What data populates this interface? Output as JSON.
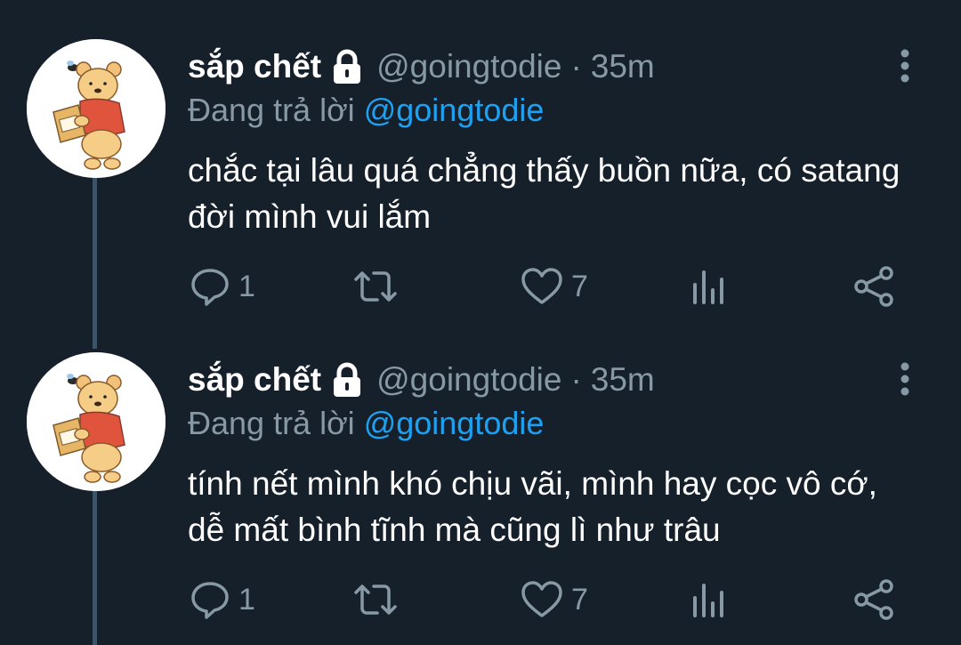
{
  "tweets": [
    {
      "display_name": "sắp chết",
      "handle": "@goingtodie",
      "separator": "·",
      "time": "35m",
      "reply_prefix": "Đang trả lời",
      "reply_to": "@goingtodie",
      "text": "chắc tại lâu quá chẳng thấy buồn nữa, có satang đời mình vui lắm",
      "reply_count": "1",
      "like_count": "7"
    },
    {
      "display_name": "sắp chết",
      "handle": "@goingtodie",
      "separator": "·",
      "time": "35m",
      "reply_prefix": "Đang trả lời",
      "reply_to": "@goingtodie",
      "text": "tính nết mình khó chịu vãi, mình hay cọc vô cớ, dễ mất bình tĩnh mà cũng lì như trâu",
      "reply_count": "1",
      "like_count": "7"
    }
  ],
  "icons": {
    "lock": "lock-icon",
    "more": "more-vertical-icon",
    "reply": "reply-bubble-icon",
    "retweet": "retweet-icon",
    "like": "heart-icon",
    "analytics": "analytics-icon",
    "share": "share-icon"
  },
  "colors": {
    "background": "#15202b",
    "secondary_text": "#8899a6",
    "accent": "#1da1f2",
    "thread_line": "#3d5466"
  }
}
